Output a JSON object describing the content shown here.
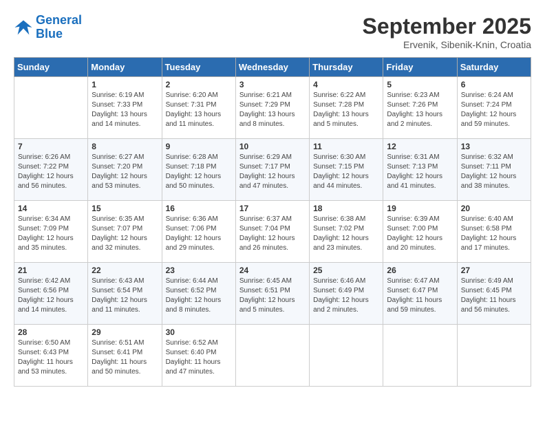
{
  "header": {
    "logo": {
      "line1": "General",
      "line2": "Blue"
    },
    "title": "September 2025",
    "location": "Ervenik, Sibenik-Knin, Croatia"
  },
  "weekdays": [
    "Sunday",
    "Monday",
    "Tuesday",
    "Wednesday",
    "Thursday",
    "Friday",
    "Saturday"
  ],
  "weeks": [
    [
      {
        "day": "",
        "info": ""
      },
      {
        "day": "1",
        "info": "Sunrise: 6:19 AM\nSunset: 7:33 PM\nDaylight: 13 hours\nand 14 minutes."
      },
      {
        "day": "2",
        "info": "Sunrise: 6:20 AM\nSunset: 7:31 PM\nDaylight: 13 hours\nand 11 minutes."
      },
      {
        "day": "3",
        "info": "Sunrise: 6:21 AM\nSunset: 7:29 PM\nDaylight: 13 hours\nand 8 minutes."
      },
      {
        "day": "4",
        "info": "Sunrise: 6:22 AM\nSunset: 7:28 PM\nDaylight: 13 hours\nand 5 minutes."
      },
      {
        "day": "5",
        "info": "Sunrise: 6:23 AM\nSunset: 7:26 PM\nDaylight: 13 hours\nand 2 minutes."
      },
      {
        "day": "6",
        "info": "Sunrise: 6:24 AM\nSunset: 7:24 PM\nDaylight: 12 hours\nand 59 minutes."
      }
    ],
    [
      {
        "day": "7",
        "info": "Sunrise: 6:26 AM\nSunset: 7:22 PM\nDaylight: 12 hours\nand 56 minutes."
      },
      {
        "day": "8",
        "info": "Sunrise: 6:27 AM\nSunset: 7:20 PM\nDaylight: 12 hours\nand 53 minutes."
      },
      {
        "day": "9",
        "info": "Sunrise: 6:28 AM\nSunset: 7:18 PM\nDaylight: 12 hours\nand 50 minutes."
      },
      {
        "day": "10",
        "info": "Sunrise: 6:29 AM\nSunset: 7:17 PM\nDaylight: 12 hours\nand 47 minutes."
      },
      {
        "day": "11",
        "info": "Sunrise: 6:30 AM\nSunset: 7:15 PM\nDaylight: 12 hours\nand 44 minutes."
      },
      {
        "day": "12",
        "info": "Sunrise: 6:31 AM\nSunset: 7:13 PM\nDaylight: 12 hours\nand 41 minutes."
      },
      {
        "day": "13",
        "info": "Sunrise: 6:32 AM\nSunset: 7:11 PM\nDaylight: 12 hours\nand 38 minutes."
      }
    ],
    [
      {
        "day": "14",
        "info": "Sunrise: 6:34 AM\nSunset: 7:09 PM\nDaylight: 12 hours\nand 35 minutes."
      },
      {
        "day": "15",
        "info": "Sunrise: 6:35 AM\nSunset: 7:07 PM\nDaylight: 12 hours\nand 32 minutes."
      },
      {
        "day": "16",
        "info": "Sunrise: 6:36 AM\nSunset: 7:06 PM\nDaylight: 12 hours\nand 29 minutes."
      },
      {
        "day": "17",
        "info": "Sunrise: 6:37 AM\nSunset: 7:04 PM\nDaylight: 12 hours\nand 26 minutes."
      },
      {
        "day": "18",
        "info": "Sunrise: 6:38 AM\nSunset: 7:02 PM\nDaylight: 12 hours\nand 23 minutes."
      },
      {
        "day": "19",
        "info": "Sunrise: 6:39 AM\nSunset: 7:00 PM\nDaylight: 12 hours\nand 20 minutes."
      },
      {
        "day": "20",
        "info": "Sunrise: 6:40 AM\nSunset: 6:58 PM\nDaylight: 12 hours\nand 17 minutes."
      }
    ],
    [
      {
        "day": "21",
        "info": "Sunrise: 6:42 AM\nSunset: 6:56 PM\nDaylight: 12 hours\nand 14 minutes."
      },
      {
        "day": "22",
        "info": "Sunrise: 6:43 AM\nSunset: 6:54 PM\nDaylight: 12 hours\nand 11 minutes."
      },
      {
        "day": "23",
        "info": "Sunrise: 6:44 AM\nSunset: 6:52 PM\nDaylight: 12 hours\nand 8 minutes."
      },
      {
        "day": "24",
        "info": "Sunrise: 6:45 AM\nSunset: 6:51 PM\nDaylight: 12 hours\nand 5 minutes."
      },
      {
        "day": "25",
        "info": "Sunrise: 6:46 AM\nSunset: 6:49 PM\nDaylight: 12 hours\nand 2 minutes."
      },
      {
        "day": "26",
        "info": "Sunrise: 6:47 AM\nSunset: 6:47 PM\nDaylight: 11 hours\nand 59 minutes."
      },
      {
        "day": "27",
        "info": "Sunrise: 6:49 AM\nSunset: 6:45 PM\nDaylight: 11 hours\nand 56 minutes."
      }
    ],
    [
      {
        "day": "28",
        "info": "Sunrise: 6:50 AM\nSunset: 6:43 PM\nDaylight: 11 hours\nand 53 minutes."
      },
      {
        "day": "29",
        "info": "Sunrise: 6:51 AM\nSunset: 6:41 PM\nDaylight: 11 hours\nand 50 minutes."
      },
      {
        "day": "30",
        "info": "Sunrise: 6:52 AM\nSunset: 6:40 PM\nDaylight: 11 hours\nand 47 minutes."
      },
      {
        "day": "",
        "info": ""
      },
      {
        "day": "",
        "info": ""
      },
      {
        "day": "",
        "info": ""
      },
      {
        "day": "",
        "info": ""
      }
    ]
  ]
}
